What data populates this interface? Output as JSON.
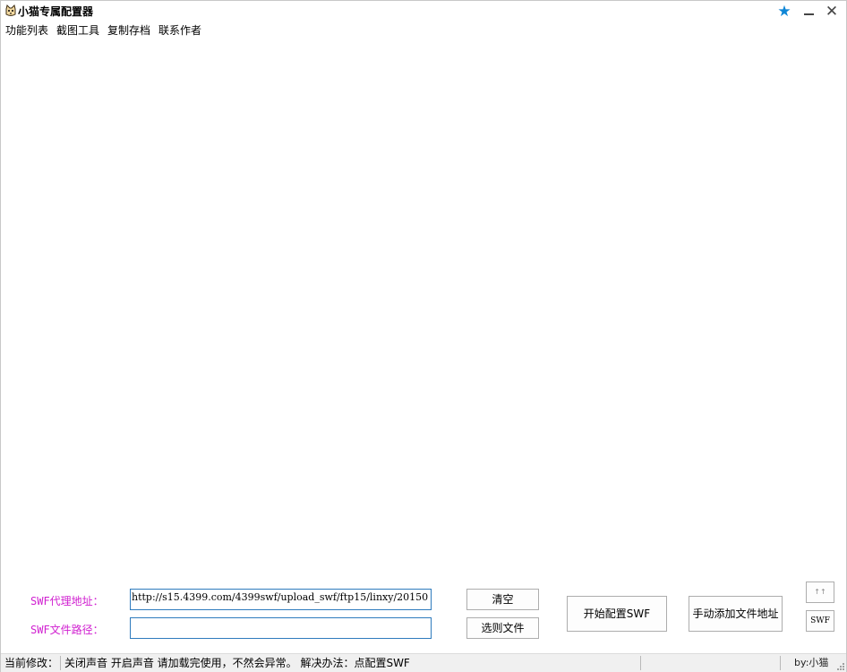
{
  "window": {
    "title": "小猫专属配置器",
    "controls": {
      "star": "★",
      "close": "✕"
    }
  },
  "menu": [
    "功能列表",
    "截图工具",
    "复制存档",
    "联系作者"
  ],
  "form": {
    "proxy_label": "SWF代理地址：",
    "proxy_value": "http://s15.4399.com/4399swf/upload_swf/ftp15/linxy/20150",
    "path_label": "SWF文件路径：",
    "path_value": ""
  },
  "buttons": {
    "clear": "清空",
    "choose_file": "选则文件",
    "start_config": "开始配置SWF",
    "manual_add": "手动添加文件地址",
    "small_top": "↑↑",
    "swf": "SWF"
  },
  "status": {
    "label": "当前修改：",
    "message": "关闭声音 开启声音 请加载完使用，不然会异常。 解决办法：点配置SWF",
    "right": "by:小猫"
  },
  "colors": {
    "label_magenta": "#d020d0",
    "input_border": "#2e7bbd",
    "star_blue": "#0f86d6"
  },
  "icons": [
    "app-cat-icon",
    "star-icon",
    "minimize-icon",
    "close-icon",
    "resize-grip-icon"
  ]
}
